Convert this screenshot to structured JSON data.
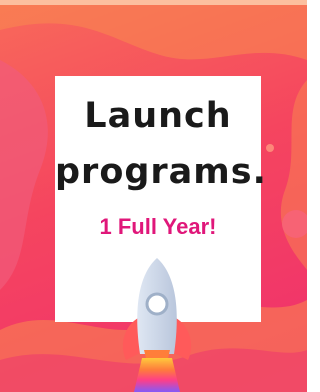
{
  "poster": {
    "headline_line1": "Launch",
    "headline_line2": "programs.",
    "subheadline": "1 Full Year!"
  },
  "icons": {
    "rocket": "rocket-icon",
    "blob_shapes": "decorative-wave-shapes"
  },
  "colors": {
    "background": "#f5455f",
    "headline": "#1a1a1a",
    "subheadline": "#e0177a",
    "card": "#ffffff"
  }
}
